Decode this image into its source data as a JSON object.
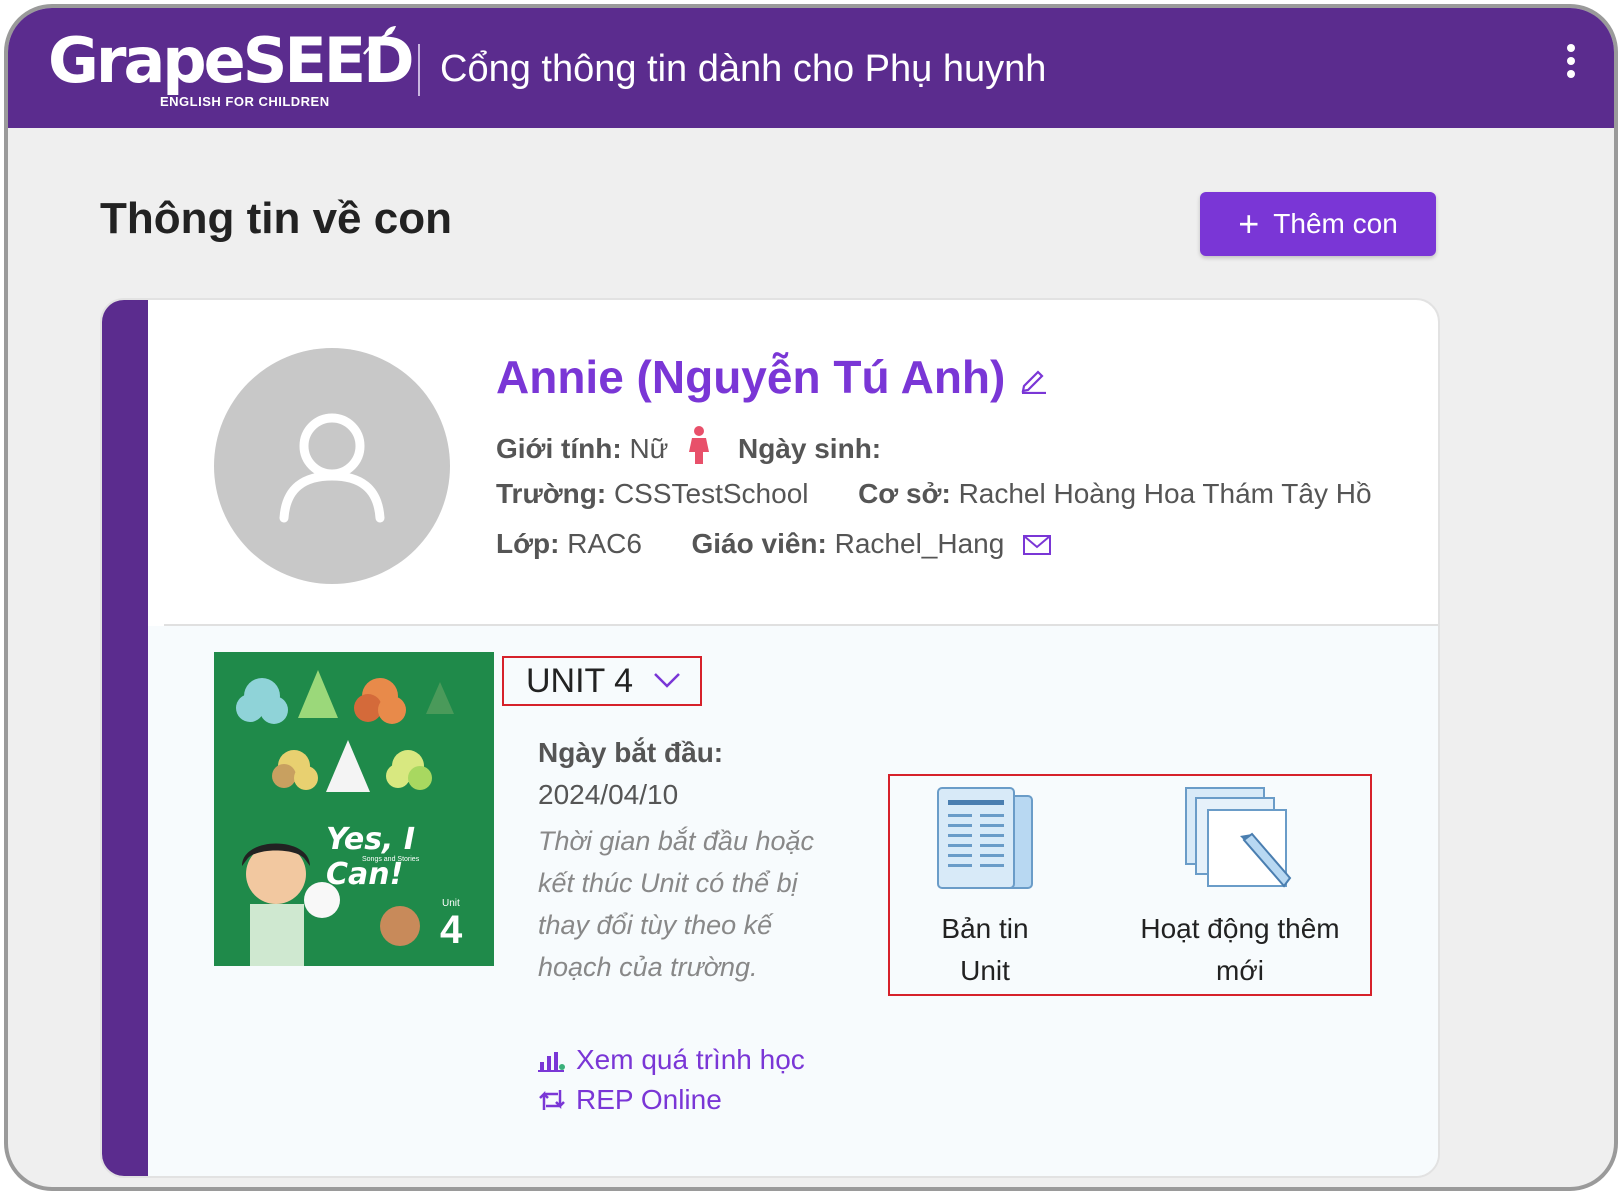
{
  "header": {
    "logo_text": "GrapeSEED",
    "logo_tagline": "ENGLISH FOR CHILDREN",
    "portal_title": "Cổng thông tin dành cho Phụ huynh"
  },
  "page": {
    "title": "Thông tin về con",
    "add_child_label": "Thêm con"
  },
  "child": {
    "name": "Annie (Nguyễn Tú Anh)",
    "gender_label": "Giới tính:",
    "gender_value": "Nữ",
    "birthday_label": "Ngày sinh:",
    "birthday_value": "",
    "school_label": "Trường:",
    "school_value": "CSSTestSchool",
    "campus_label": "Cơ sở:",
    "campus_value": "Rachel Hoàng Hoa Thám Tây Hồ",
    "class_label": "Lớp:",
    "class_value": "RAC6",
    "teacher_label": "Giáo viên:",
    "teacher_value": "Rachel_Hang"
  },
  "unit": {
    "selected": "UNIT 4",
    "cover_title": "Yes, I Can!",
    "cover_subtitle": "Songs and Stories",
    "cover_unit_label": "Unit",
    "cover_unit_number": "4",
    "start_label": "Ngày bắt đầu:",
    "start_value": "2024/04/10",
    "note": "Thời gian bắt đầu hoặc kết thúc Unit có thể bị thay đổi tùy theo kế hoạch của trường.",
    "link_progress": "Xem quá trình học",
    "link_rep": "REP Online",
    "resource_newsletter_line1": "Bản tin",
    "resource_newsletter_line2": "Unit",
    "resource_activity_line1": "Hoạt động thêm",
    "resource_activity_line2": "mới"
  },
  "colors": {
    "brand_purple": "#5b2c8e",
    "accent_purple": "#7a36d6",
    "highlight_red": "#d6212a",
    "cover_green": "#1f8a4a"
  }
}
